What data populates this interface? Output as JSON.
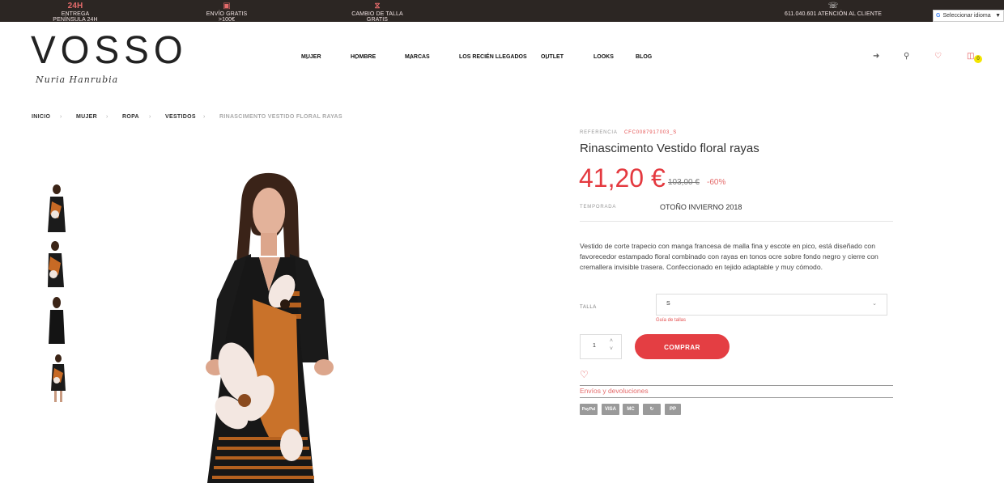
{
  "topbar": {
    "items": [
      {
        "icon": "24H",
        "text": "ENTREGA PENÍNSULA 24H"
      },
      {
        "icon": "gift-icon",
        "text": "ENVÍO GRATIS >100€"
      },
      {
        "icon": "exchange-icon",
        "text": "CAMBIO DE TALLA GRATIS"
      },
      {
        "icon": "whatsapp-icon",
        "text": "611.040.601 ATENCIÓN AL CLIENTE"
      }
    ],
    "language_label": "Seleccionar idioma"
  },
  "logo": {
    "brand": "VOSSO",
    "signature": "Nuria Hanrubia"
  },
  "nav": {
    "items": [
      {
        "label": "MUJER",
        "dropdown": true
      },
      {
        "label": "HOMBRE",
        "dropdown": true
      },
      {
        "label": "MARCAS",
        "dropdown": true
      },
      {
        "label": "LOS RECIÉN LLEGADOS",
        "dropdown": false
      },
      {
        "label": "OUTLET",
        "dropdown": true
      },
      {
        "label": "LOOKS",
        "dropdown": false
      },
      {
        "label": "BLOG",
        "dropdown": false
      }
    ]
  },
  "header_icons": {
    "login": "login-icon",
    "search": "search-icon",
    "wishlist": "heart-icon",
    "cart": "bag-icon",
    "cart_count": "0"
  },
  "breadcrumb": [
    "INICIO",
    "MUJER",
    "ROPA",
    "VESTIDOS",
    "RINASCIMENTO VESTIDO FLORAL RAYAS"
  ],
  "product": {
    "reference_label": "REFERENCIA",
    "reference_value": "CFC0087917003_S",
    "title": "Rinascimento Vestido floral rayas",
    "price": "41,20 €",
    "old_price": "103,00 €",
    "discount": "-60%",
    "season_label": "TEMPORADA",
    "season_value": "OTOÑO INVIERNO 2018",
    "description": "Vestido de corte trapecio con manga francesa de malla fina y escote en pico, está diseñado con favorecedor estampado floral combinado con rayas en tonos ocre sobre fondo negro y cierre con cremallera invisible trasera. Confeccionado en tejido adaptable y muy cómodo.",
    "size_label": "TALLA",
    "size_value": "S",
    "size_guide": "Guía de tallas",
    "quantity": "1",
    "buy_label": "COMPRAR",
    "shipping_link": "Envíos y devoluciones"
  },
  "payments": [
    "PayPal",
    "VISA",
    "MC",
    "↻",
    "PP"
  ],
  "colors": {
    "accent": "#e43e43",
    "topbar": "#2c2623"
  }
}
